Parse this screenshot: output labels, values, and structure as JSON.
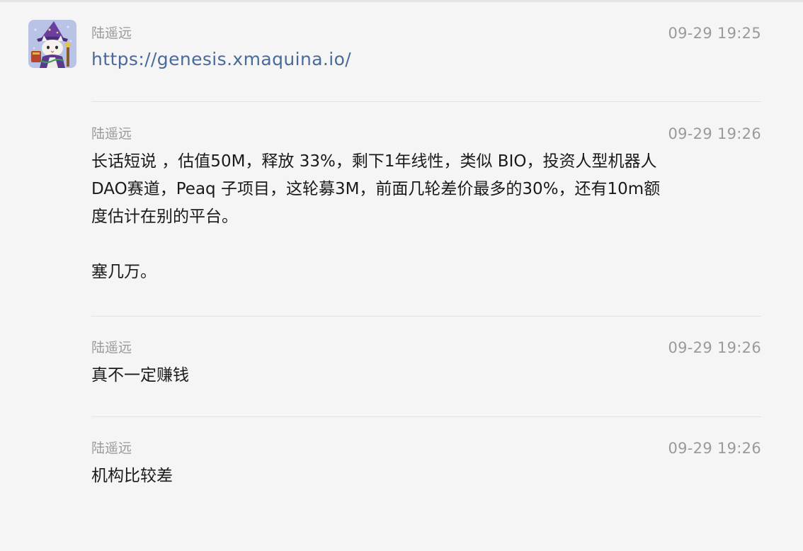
{
  "messages": [
    {
      "sender": "陆遥远",
      "time": "09-29 19:25",
      "link": "https://genesis.xmaquina.io/",
      "has_avatar": true
    },
    {
      "sender": "陆遥远",
      "time": "09-29 19:26",
      "text": "长话短说 ，估值50M，释放 33%，剩下1年线性，类似 BIO，投资人型机器人\nDAO赛道，Peaq 子项目，这轮募3M，前面几轮差价最多的30%，还有10m额\n度估计在别的平台。\n\n塞几万。"
    },
    {
      "sender": "陆遥远",
      "time": "09-29 19:26",
      "text": "真不一定赚钱"
    },
    {
      "sender": "陆遥远",
      "time": "09-29 19:26",
      "text": "机构比较差"
    }
  ],
  "colors": {
    "background": "#f5f5f5",
    "meta_text": "#9a9a9a",
    "body_text": "#1a1a1a",
    "link": "#4a6a99",
    "divider": "#e2e2e2"
  },
  "icons": {
    "avatar": "wizard-cat-avatar"
  }
}
